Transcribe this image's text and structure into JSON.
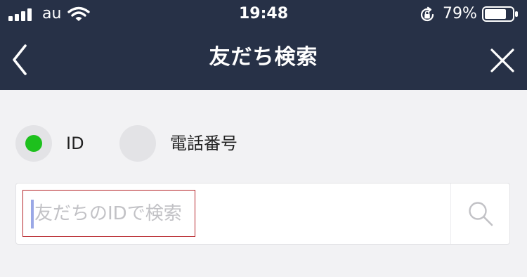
{
  "status_bar": {
    "carrier": "au",
    "time": "19:48",
    "battery_percent": "79%",
    "battery_level": 0.79,
    "icons": [
      "signal-icon",
      "wifi-icon",
      "rotation-lock-icon",
      "battery-icon"
    ]
  },
  "nav": {
    "title": "友だち検索",
    "back_icon": "chevron-left-icon",
    "close_icon": "close-icon"
  },
  "search_type": {
    "selected": "ID",
    "options": [
      {
        "label": "ID",
        "selected": true
      },
      {
        "label": "電話番号",
        "selected": false
      }
    ]
  },
  "search": {
    "value": "",
    "placeholder": "友だちのIDで検索",
    "button_icon": "search-icon"
  },
  "colors": {
    "header": "#273147",
    "background": "#f2f2f4",
    "selected_radio": "#1dc01d",
    "highlight_border": "#b7262b",
    "caret": "#9aa8e6"
  }
}
